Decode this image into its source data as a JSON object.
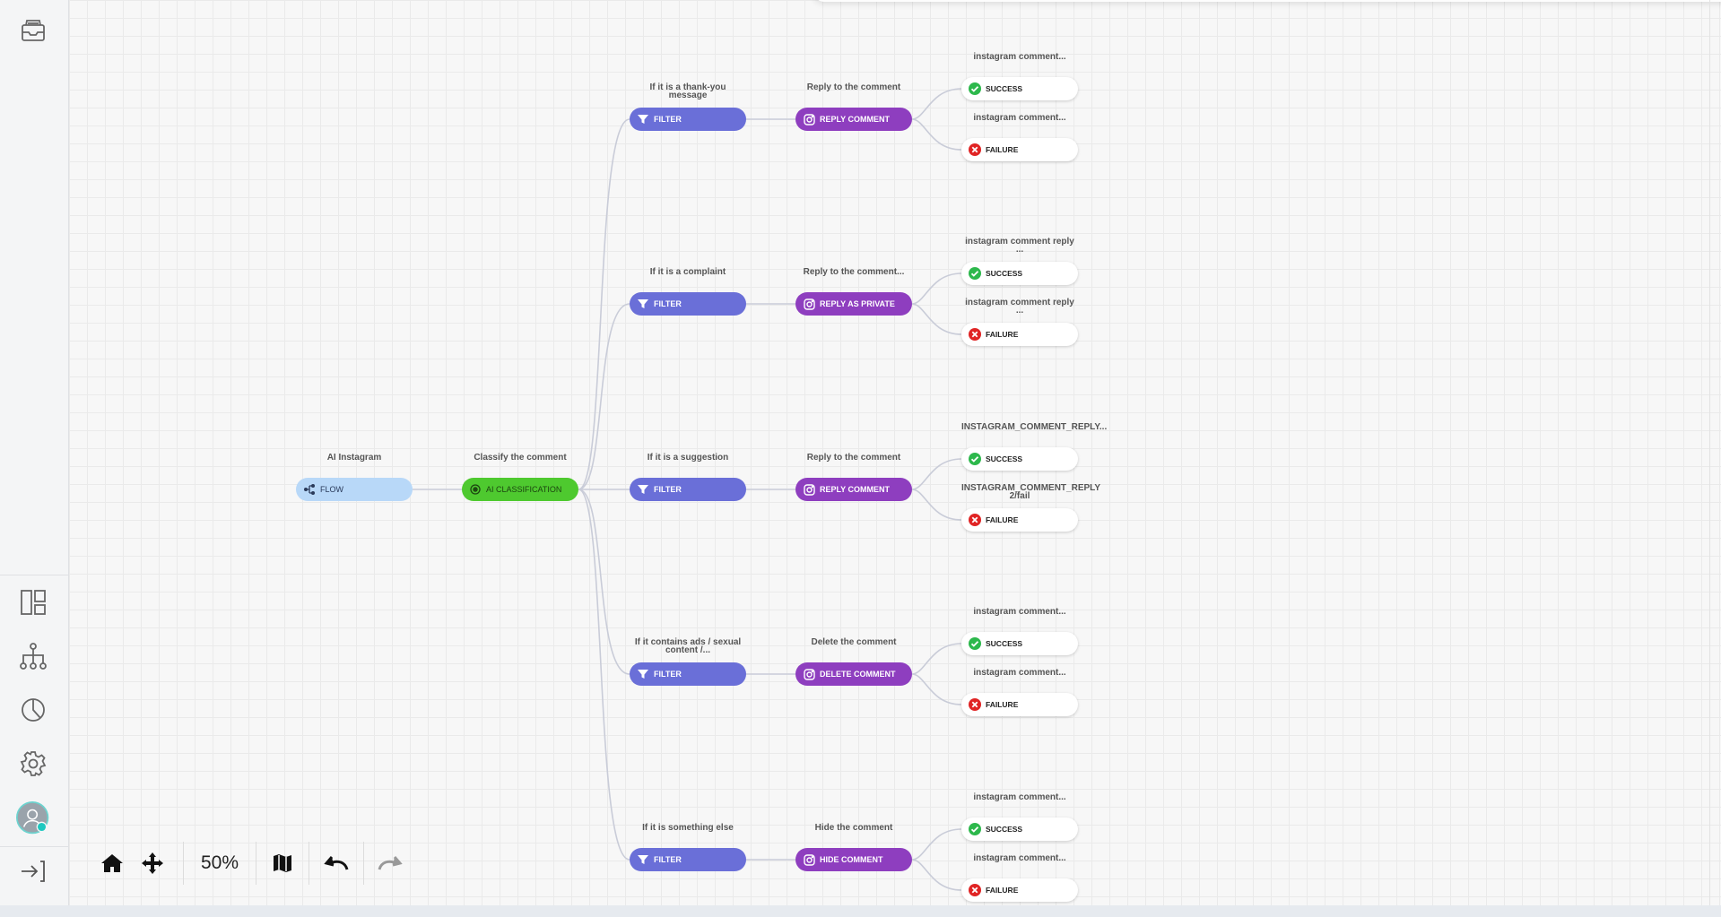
{
  "toolbar": {
    "zoom": "50%"
  },
  "nodes": {
    "root": {
      "title": "AI Instagram",
      "label": "FLOW"
    },
    "classify": {
      "title": "Classify the comment",
      "label": "AI CLASSIFICATION"
    }
  },
  "branches": [
    {
      "filter_title": "If it is a thank-you message",
      "filter_label": "FILTER",
      "action_title": "Reply to the comment",
      "action_label": "REPLY COMMENT",
      "success_title": "instagram comment...",
      "success_label": "SUCCESS",
      "failure_title": "instagram comment...",
      "failure_label": "FAILURE"
    },
    {
      "filter_title": "If it is a complaint",
      "filter_label": "FILTER",
      "action_title": "Reply to the comment...",
      "action_label": "REPLY AS PRIVATE",
      "success_title": "instagram comment reply ...",
      "success_label": "SUCCESS",
      "failure_title": "instagram comment reply ...",
      "failure_label": "FAILURE"
    },
    {
      "filter_title": "If it is a suggestion",
      "filter_label": "FILTER",
      "action_title": "Reply to the comment",
      "action_label": "REPLY COMMENT",
      "success_title": "INSTAGRAM_COMMENT_REPLY...",
      "success_label": "SUCCESS",
      "failure_title": "INSTAGRAM_COMMENT_REPLY 2/fail",
      "failure_label": "FAILURE"
    },
    {
      "filter_title": "If it contains ads / sexual content /...",
      "filter_label": "FILTER",
      "action_title": "Delete the comment",
      "action_label": "DELETE COMMENT",
      "success_title": "instagram comment...",
      "success_label": "SUCCESS",
      "failure_title": "instagram comment...",
      "failure_label": "FAILURE"
    },
    {
      "filter_title": "If it is something else",
      "filter_label": "FILTER",
      "action_title": "Hide the comment",
      "action_label": "HIDE COMMENT",
      "success_title": "instagram comment...",
      "success_label": "SUCCESS",
      "failure_title": "instagram comment...",
      "failure_label": "FAILURE"
    }
  ],
  "colors": {
    "filter": "#6a6fd8",
    "action": "#8e3ebf",
    "flow": "#b8d8f8",
    "ai": "#4ec92f",
    "success": "#2db84c",
    "failure": "#e02424",
    "status_dot": "#1ec8c0"
  },
  "icons": {
    "sidebar": [
      "inbox-icon",
      "dashboard-layout-icon",
      "hierarchy-icon",
      "pie-chart-icon",
      "gear-icon",
      "avatar-icon",
      "logout-icon"
    ],
    "toolbar": [
      "home-icon",
      "move-arrows-icon",
      "map-icon",
      "undo-icon",
      "redo-icon"
    ],
    "nodes": [
      "flow-icon",
      "ai-brain-icon",
      "filter-icon",
      "instagram-icon",
      "check-circle-icon",
      "x-circle-icon"
    ]
  }
}
